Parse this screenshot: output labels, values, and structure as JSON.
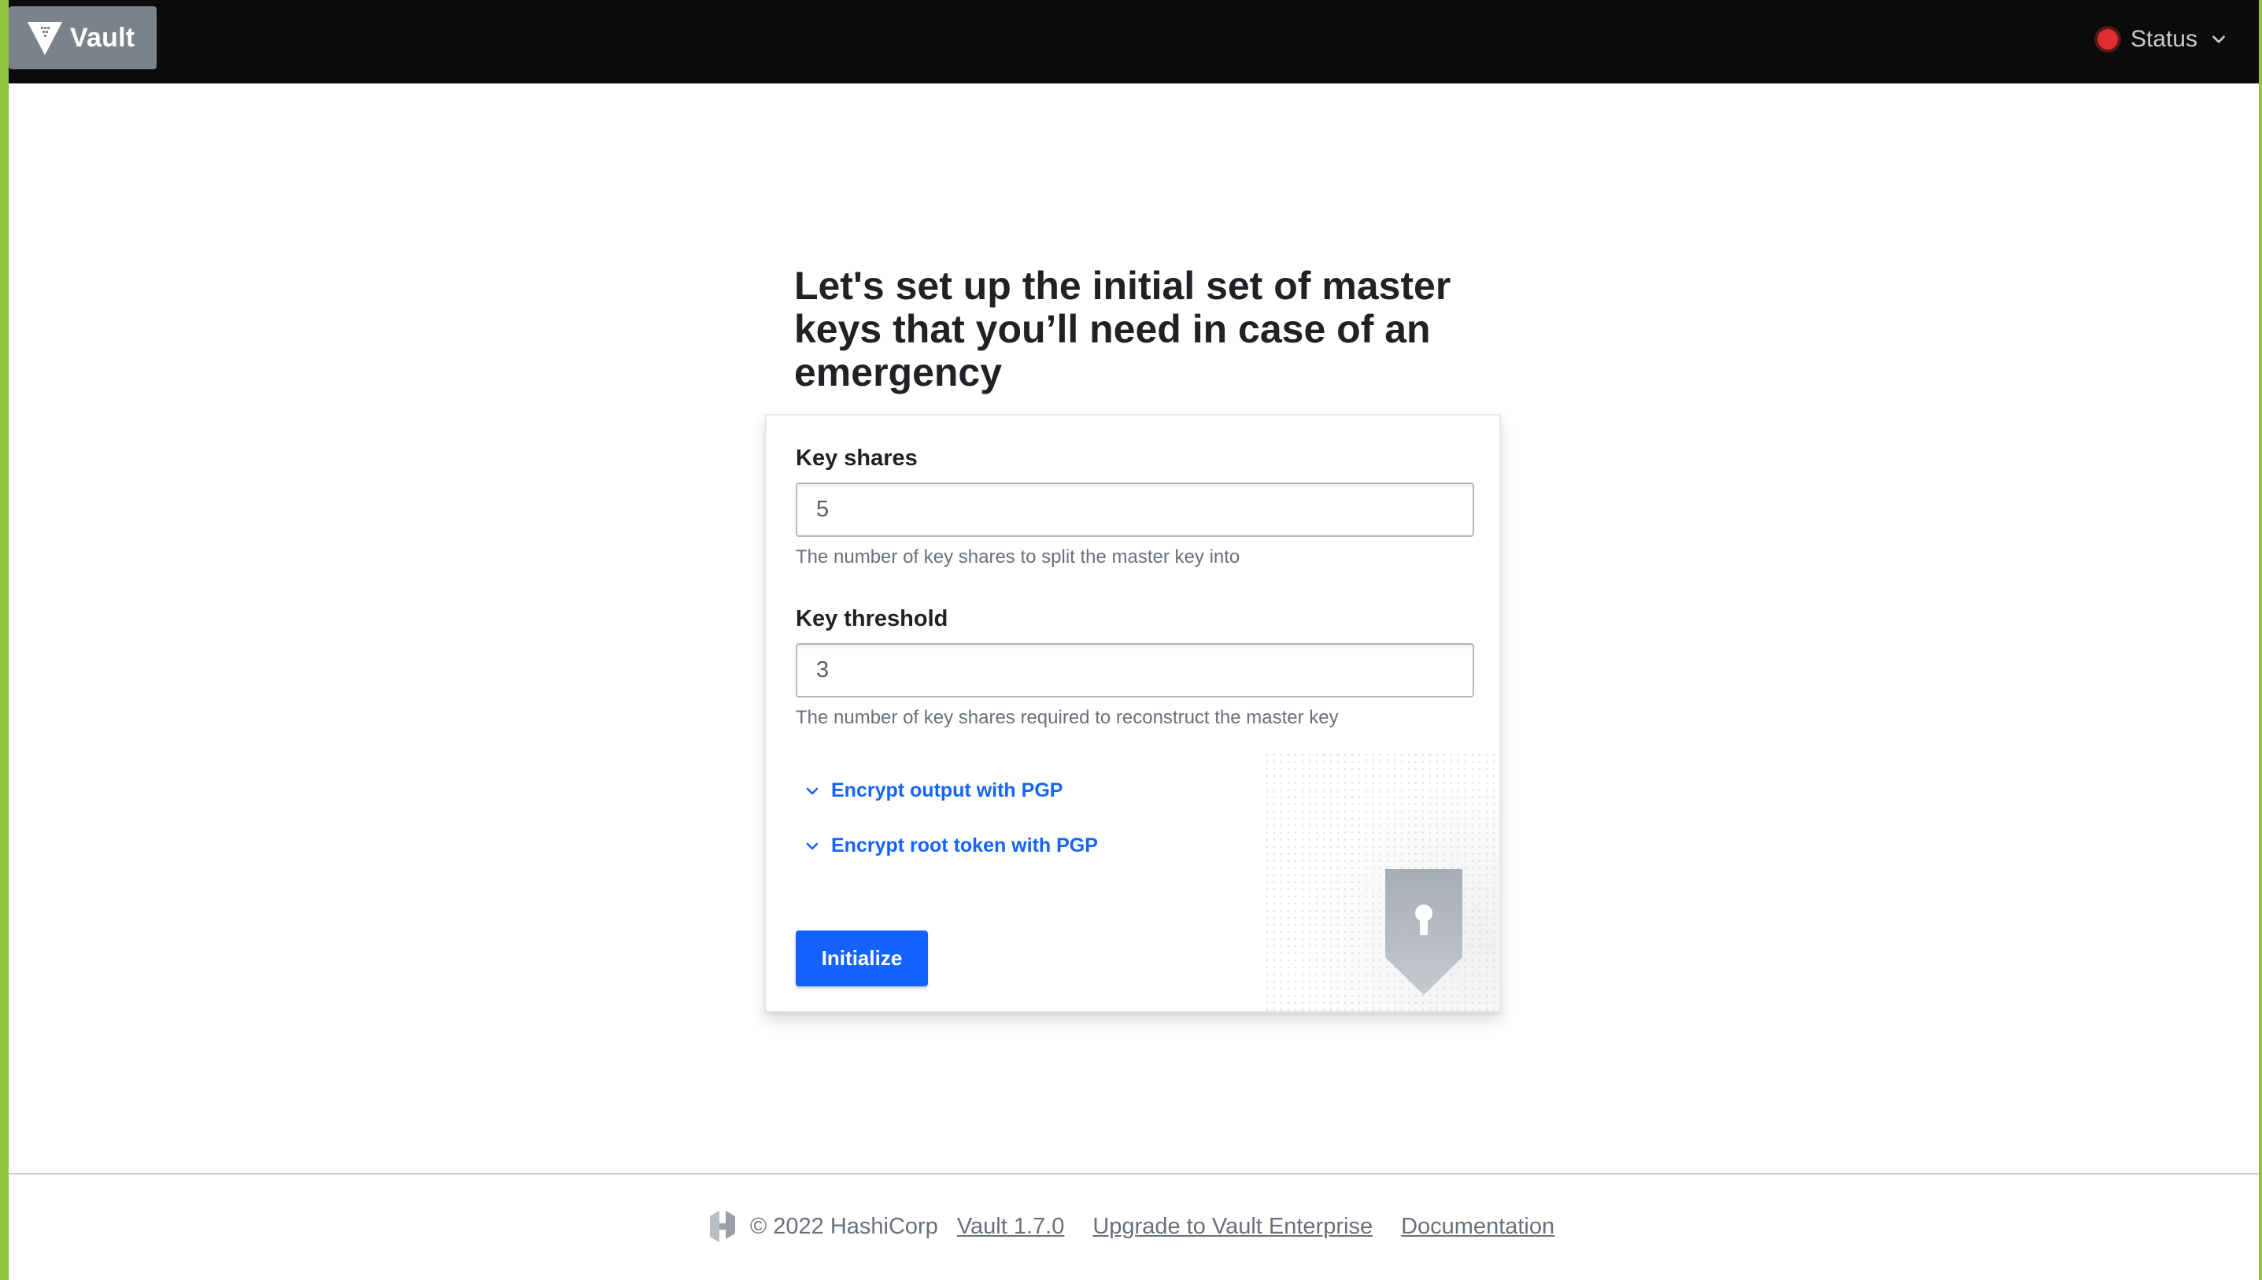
{
  "header": {
    "brand_name": "Vault",
    "status_label": "Status",
    "status_color": "#e02e2e"
  },
  "main": {
    "heading": "Let's set up the initial set of master keys that you’ll need in case of an emergency",
    "key_shares": {
      "label": "Key shares",
      "value": "5",
      "help": "The number of key shares to split the master key into"
    },
    "key_threshold": {
      "label": "Key threshold",
      "value": "3",
      "help": "The number of key shares required to reconstruct the master key"
    },
    "toggles": [
      {
        "label": "Encrypt output with PGP",
        "icon": "chevron-down-icon"
      },
      {
        "label": "Encrypt root token with PGP",
        "icon": "chevron-down-icon"
      }
    ],
    "submit_label": "Initialize",
    "accent_color": "#1563ff"
  },
  "footer": {
    "copyright": "© 2022 HashiCorp",
    "version_link": "Vault 1.7.0",
    "upgrade_link": "Upgrade to Vault Enterprise",
    "docs_link": "Documentation"
  }
}
